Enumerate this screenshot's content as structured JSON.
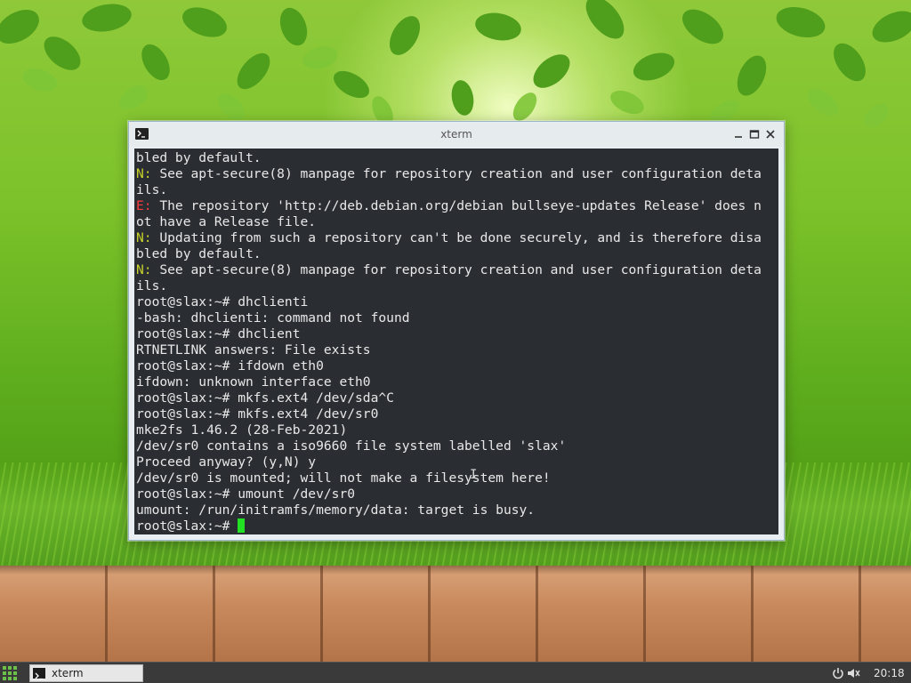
{
  "window": {
    "title": "xterm"
  },
  "terminal": {
    "lines": [
      {
        "prefix": "",
        "text": "bled by default."
      },
      {
        "prefix": "N:",
        "text": " See apt-secure(8) manpage for repository creation and user configuration deta"
      },
      {
        "prefix": "",
        "text": "ils."
      },
      {
        "prefix": "E:",
        "text": " The repository 'http://deb.debian.org/debian bullseye-updates Release' does n"
      },
      {
        "prefix": "",
        "text": "ot have a Release file."
      },
      {
        "prefix": "N:",
        "text": " Updating from such a repository can't be done securely, and is therefore disa"
      },
      {
        "prefix": "",
        "text": "bled by default."
      },
      {
        "prefix": "N:",
        "text": " See apt-secure(8) manpage for repository creation and user configuration deta"
      },
      {
        "prefix": "",
        "text": "ils."
      },
      {
        "prefix": "",
        "text": "root@slax:~# dhclienti"
      },
      {
        "prefix": "",
        "text": "-bash: dhclienti: command not found"
      },
      {
        "prefix": "",
        "text": "root@slax:~# dhclient"
      },
      {
        "prefix": "",
        "text": "RTNETLINK answers: File exists"
      },
      {
        "prefix": "",
        "text": "root@slax:~# ifdown eth0"
      },
      {
        "prefix": "",
        "text": "ifdown: unknown interface eth0"
      },
      {
        "prefix": "",
        "text": "root@slax:~# mkfs.ext4 /dev/sda^C"
      },
      {
        "prefix": "",
        "text": "root@slax:~# mkfs.ext4 /dev/sr0"
      },
      {
        "prefix": "",
        "text": "mke2fs 1.46.2 (28-Feb-2021)"
      },
      {
        "prefix": "",
        "text": "/dev/sr0 contains a iso9660 file system labelled 'slax'"
      },
      {
        "prefix": "",
        "text": "Proceed anyway? (y,N) y"
      },
      {
        "prefix": "",
        "text": "/dev/sr0 is mounted; will not make a filesystem here!"
      },
      {
        "prefix": "",
        "text": "root@slax:~# umount /dev/sr0"
      },
      {
        "prefix": "",
        "text": "umount: /run/initramfs/memory/data: target is busy."
      }
    ],
    "prompt": "root@slax:~# ",
    "colors": {
      "background": "#2a2e33",
      "foreground": "#e8e8e8",
      "notice": "#c8d22a",
      "error": "#ff3b3b",
      "cursor": "#22e022"
    }
  },
  "taskbar": {
    "task_label": "xterm",
    "clock": "20:18",
    "icons": [
      "start-menu-icon",
      "terminal-icon",
      "power-icon",
      "volume-muted-icon"
    ]
  }
}
